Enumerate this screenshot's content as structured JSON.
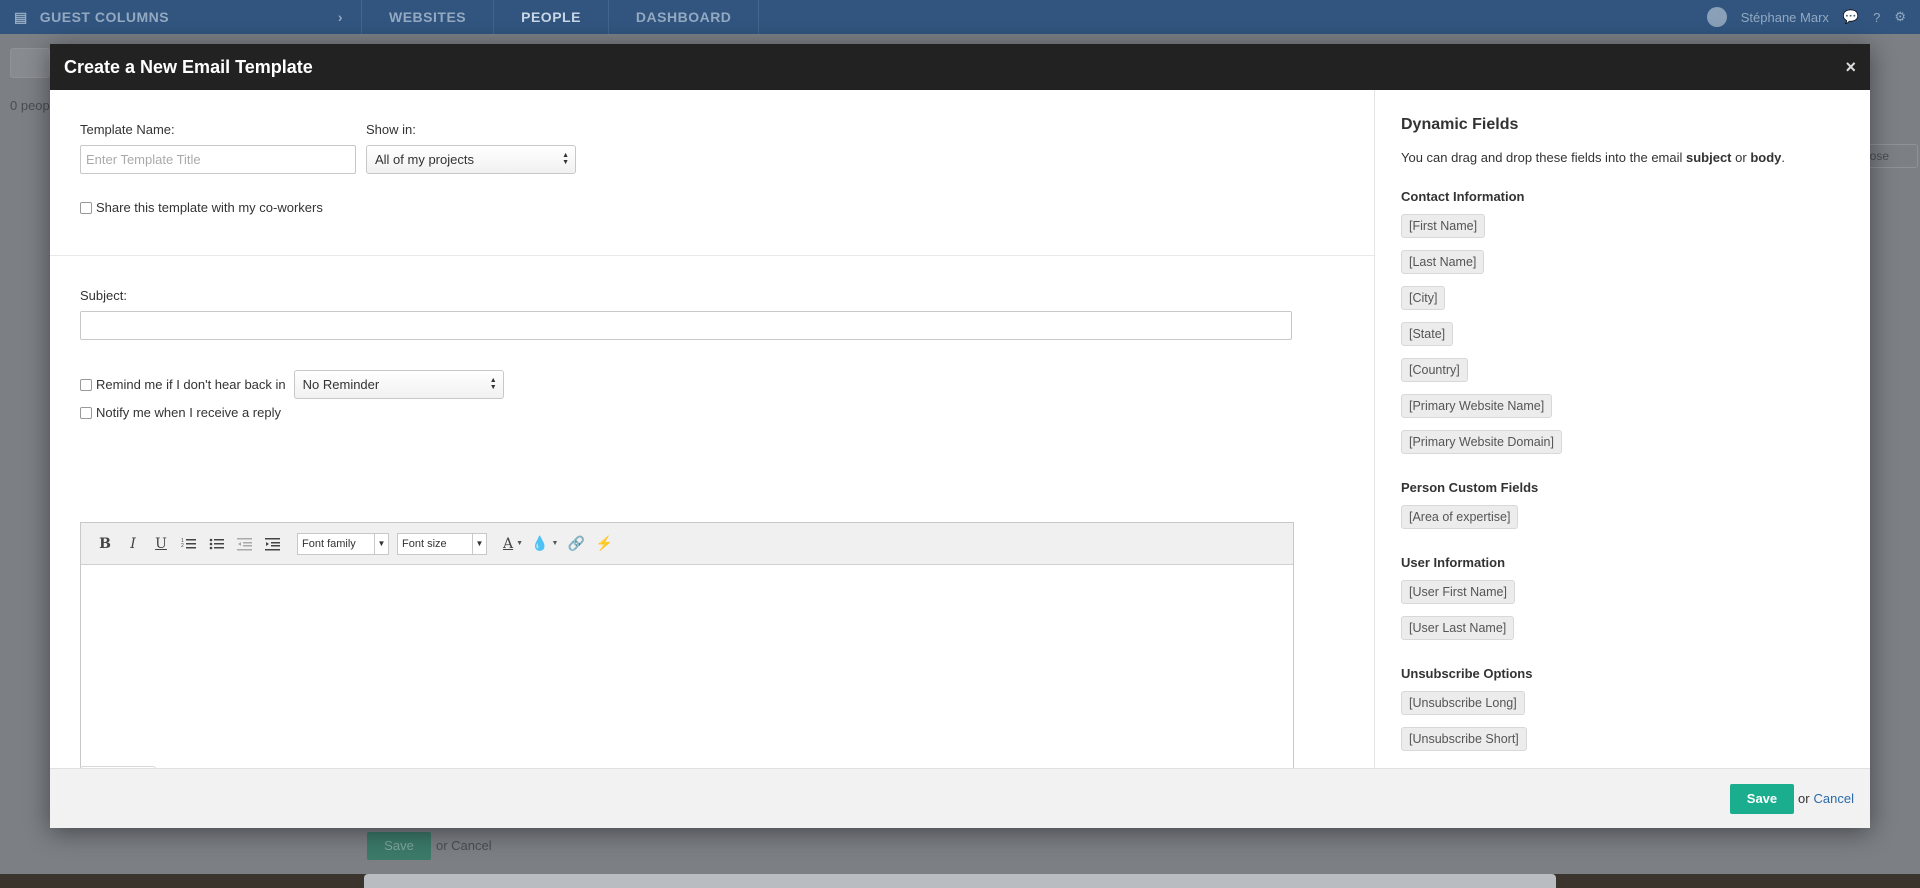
{
  "app": {
    "guest_label": "GUEST COLUMNS",
    "nav": [
      "WEBSITES",
      "PEOPLE",
      "DASHBOARD"
    ],
    "user_name": "Stéphane Marx",
    "people_count": "0 peop",
    "bg_close": "lose",
    "bg_save": "Save",
    "bg_cancel": "or Cancel"
  },
  "modal": {
    "title": "Create a New Email Template",
    "close_glyph": "×",
    "template_name_label": "Template Name:",
    "template_name_placeholder": "Enter Template Title",
    "template_name_value": "",
    "show_in_label": "Show in:",
    "show_in_value": "All of my projects",
    "share_label": "Share this template with my co-workers",
    "subject_label": "Subject:",
    "subject_value": "",
    "remind_label": "Remind me if I don't hear back in",
    "remind_value": "No Reminder",
    "notify_label": "Notify me when I receive a reply",
    "toolbar": {
      "bold": "B",
      "italic": "I",
      "underline": "U",
      "font_family": "Font family",
      "font_size": "Font size"
    },
    "save_label": "Save",
    "or_text": "or",
    "cancel_label": "Cancel"
  },
  "dynamic_fields": {
    "title": "Dynamic Fields",
    "desc_prefix": "You can drag and drop these fields into the email ",
    "desc_subject": "subject",
    "desc_or": " or ",
    "desc_body": "body",
    "desc_end": ".",
    "groups": {
      "contact": {
        "title": "Contact Information",
        "items": [
          "[First Name]",
          "[Last Name]",
          "[City]",
          "[State]",
          "[Country]",
          "[Primary Website Name]",
          "[Primary Website Domain]"
        ]
      },
      "person": {
        "title": "Person Custom Fields",
        "items": [
          "[Area of expertise]"
        ]
      },
      "user": {
        "title": "User Information",
        "items": [
          "[User First Name]",
          "[User Last Name]"
        ]
      },
      "unsubscribe": {
        "title": "Unsubscribe Options",
        "items": [
          "[Unsubscribe Long]",
          "[Unsubscribe Short]"
        ]
      }
    }
  },
  "colors": {
    "header_bg": "#222222",
    "accent_save": "#1aae8e",
    "topbar": "#31557f",
    "link": "#2a6ba8"
  }
}
